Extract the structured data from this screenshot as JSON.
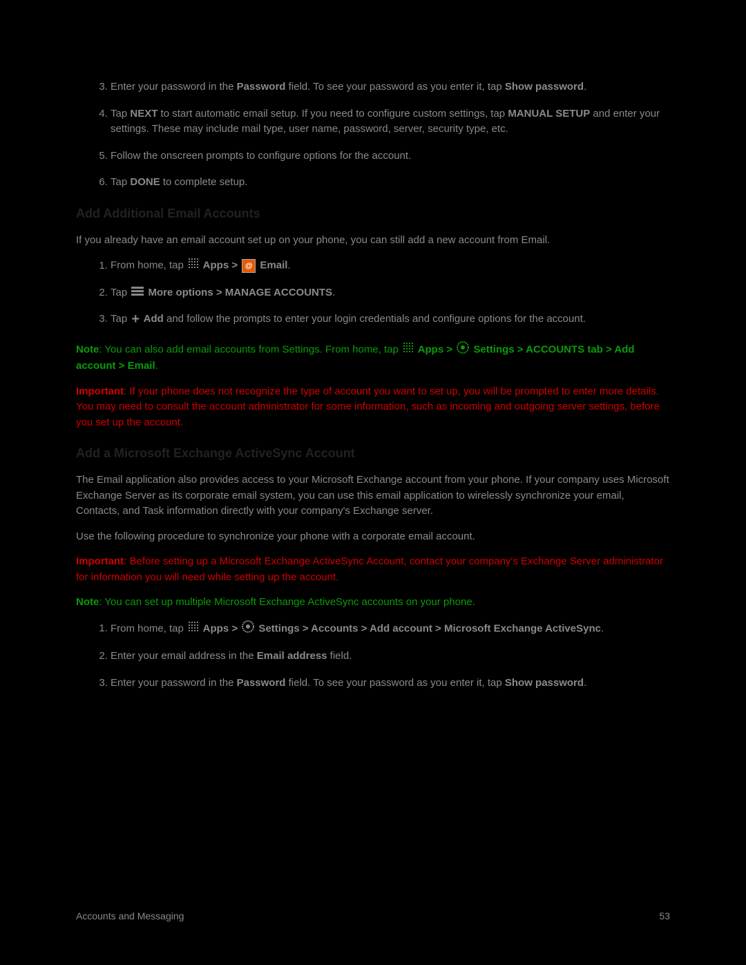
{
  "list1": {
    "item3_a": "Enter your password in the ",
    "item3_b": "Password",
    "item3_c": " field. To see your password as you enter it, tap ",
    "item3_d": "Show password",
    "item3_e": ".",
    "item4_a": "Tap ",
    "item4_b": "NEXT",
    "item4_c": " to start automatic email setup. If you need to configure custom settings, tap ",
    "item4_d": "MANUAL SETUP",
    "item4_e": " and enter your settings. These may include mail type, user name, password, server, security type, etc.",
    "item5": "Follow the onscreen prompts to configure options for the account.",
    "item6_a": "Tap ",
    "item6_b": "DONE",
    "item6_c": " to complete setup."
  },
  "heading1": "Add Additional Email Accounts",
  "para1": "If you already have an email account set up on your phone, you can still add a new account from Email.",
  "list2": {
    "item1_a": "From home, tap ",
    "item1_b": " Apps > ",
    "item1_c": " Email",
    "item1_d": ".",
    "item2_a": "Tap ",
    "item2_b": " More options > MANAGE ACCOUNTS",
    "item2_c": ".",
    "item3_a": "Tap ",
    "item3_b": " Add",
    "item3_c": " and follow the prompts to enter your login credentials and configure options for the account."
  },
  "note1": {
    "label": "Note",
    "a": ": You can also add email accounts from Settings. From home, tap ",
    "b": " Apps > ",
    "c": " Settings > ACCOUNTS tab > Add account > Email",
    "d": "."
  },
  "important1": {
    "label": "Important",
    "text": ": If your phone does not recognize the type of account you want to set up, you will be prompted to enter more details. You may need to consult the account administrator for some information, such as incoming and outgoing server settings, before you set up the account."
  },
  "heading2": "Add a Microsoft Exchange ActiveSync Account",
  "para2": "The Email application also provides access to your Microsoft Exchange account from your phone. If your company uses Microsoft Exchange Server as its corporate email system, you can use this email application to wirelessly synchronize your email, Contacts, and Task information directly with your company's Exchange server.",
  "para3": "Use the following procedure to synchronize your phone with a corporate email account.",
  "important2": {
    "label": "Important",
    "text": ": Before setting up a Microsoft Exchange ActiveSync Account, contact your company's Exchange Server administrator for information you will need while setting up the account."
  },
  "note2": {
    "label": "Note",
    "text": ": You can set up multiple Microsoft Exchange ActiveSync accounts on your phone."
  },
  "list3": {
    "item1_a": "From home, tap ",
    "item1_b": " Apps > ",
    "item1_c": " Settings > Accounts > Add account > Microsoft Exchange ActiveSync",
    "item1_d": ".",
    "item2_a": "Enter your email address in the ",
    "item2_b": "Email address",
    "item2_c": " field.",
    "item3_a": "Enter your password in the ",
    "item3_b": "Password",
    "item3_c": " field. To see your password as you enter it, tap ",
    "item3_d": "Show password",
    "item3_e": "."
  },
  "footer": {
    "left": "Accounts and Messaging",
    "right": "53"
  }
}
